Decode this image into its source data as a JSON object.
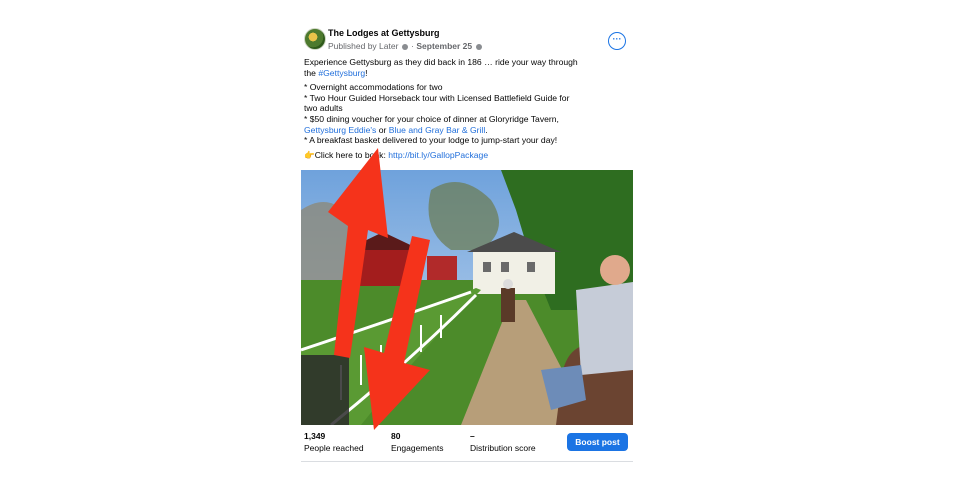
{
  "post": {
    "page_name": "The Lodges at Gettysburg",
    "published_by": "Published by Later",
    "separator": "·",
    "date": "September 25",
    "more_label": "···",
    "lines": [
      {
        "text": "Experience Gettysburg as they did back in 186 … ride your way through"
      },
      {
        "prefix": "the ",
        "link": "#Gettysburg",
        "suffix": "!"
      },
      {
        "text": "* Overnight accommodations for two"
      },
      {
        "text": "* Two Hour Guided Horseback tour with Licensed Battlefield Guide for"
      },
      {
        "text": "two adults"
      },
      {
        "text": "* $50 dining voucher for your choice of dinner at Gloryridge Tavern,"
      },
      {
        "link1": "Gettysburg Eddie's",
        "mid": " or ",
        "link2": "Blue and Gray Bar & Grill",
        "suffix": "."
      },
      {
        "text": "* A breakfast basket delivered to your lodge to jump-start your day!"
      },
      {
        "prefix": "👉Click here to book: ",
        "link": "http://bit.ly/GallopPackage"
      }
    ]
  },
  "stats": {
    "people_reached": {
      "value": "1,349",
      "label": "People reached"
    },
    "engagements": {
      "value": "80",
      "label": "Engagements"
    },
    "distribution": {
      "value": "–",
      "label": "Distribution score"
    },
    "boost_label": "Boost post"
  },
  "colors": {
    "accent": "#1b74e4",
    "link": "#216fdb",
    "annotation_arrow": "#f5331b"
  }
}
